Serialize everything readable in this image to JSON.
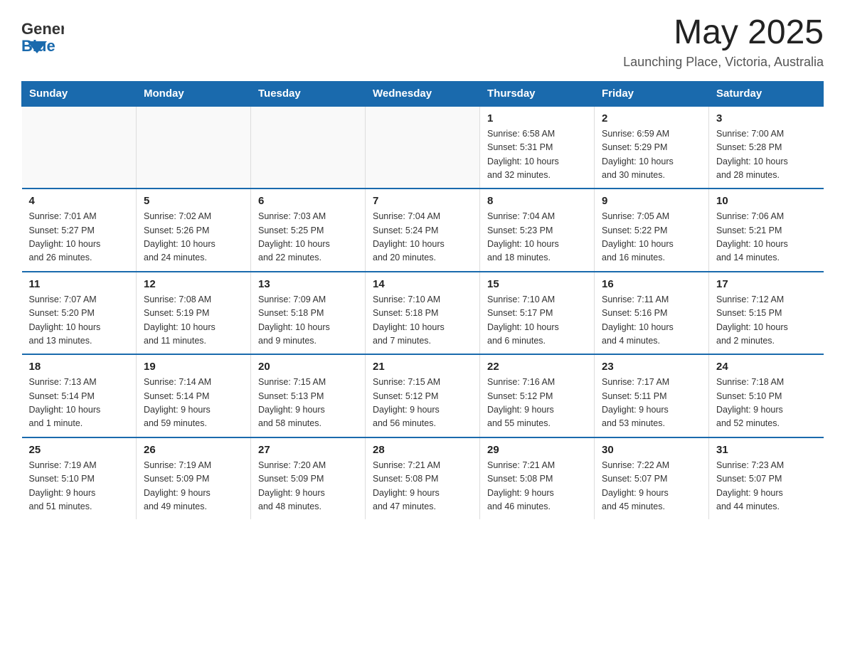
{
  "header": {
    "logo_general": "General",
    "logo_blue": "Blue",
    "month_year": "May 2025",
    "location": "Launching Place, Victoria, Australia"
  },
  "days_of_week": [
    "Sunday",
    "Monday",
    "Tuesday",
    "Wednesday",
    "Thursday",
    "Friday",
    "Saturday"
  ],
  "weeks": [
    [
      {
        "day": "",
        "info": ""
      },
      {
        "day": "",
        "info": ""
      },
      {
        "day": "",
        "info": ""
      },
      {
        "day": "",
        "info": ""
      },
      {
        "day": "1",
        "info": "Sunrise: 6:58 AM\nSunset: 5:31 PM\nDaylight: 10 hours\nand 32 minutes."
      },
      {
        "day": "2",
        "info": "Sunrise: 6:59 AM\nSunset: 5:29 PM\nDaylight: 10 hours\nand 30 minutes."
      },
      {
        "day": "3",
        "info": "Sunrise: 7:00 AM\nSunset: 5:28 PM\nDaylight: 10 hours\nand 28 minutes."
      }
    ],
    [
      {
        "day": "4",
        "info": "Sunrise: 7:01 AM\nSunset: 5:27 PM\nDaylight: 10 hours\nand 26 minutes."
      },
      {
        "day": "5",
        "info": "Sunrise: 7:02 AM\nSunset: 5:26 PM\nDaylight: 10 hours\nand 24 minutes."
      },
      {
        "day": "6",
        "info": "Sunrise: 7:03 AM\nSunset: 5:25 PM\nDaylight: 10 hours\nand 22 minutes."
      },
      {
        "day": "7",
        "info": "Sunrise: 7:04 AM\nSunset: 5:24 PM\nDaylight: 10 hours\nand 20 minutes."
      },
      {
        "day": "8",
        "info": "Sunrise: 7:04 AM\nSunset: 5:23 PM\nDaylight: 10 hours\nand 18 minutes."
      },
      {
        "day": "9",
        "info": "Sunrise: 7:05 AM\nSunset: 5:22 PM\nDaylight: 10 hours\nand 16 minutes."
      },
      {
        "day": "10",
        "info": "Sunrise: 7:06 AM\nSunset: 5:21 PM\nDaylight: 10 hours\nand 14 minutes."
      }
    ],
    [
      {
        "day": "11",
        "info": "Sunrise: 7:07 AM\nSunset: 5:20 PM\nDaylight: 10 hours\nand 13 minutes."
      },
      {
        "day": "12",
        "info": "Sunrise: 7:08 AM\nSunset: 5:19 PM\nDaylight: 10 hours\nand 11 minutes."
      },
      {
        "day": "13",
        "info": "Sunrise: 7:09 AM\nSunset: 5:18 PM\nDaylight: 10 hours\nand 9 minutes."
      },
      {
        "day": "14",
        "info": "Sunrise: 7:10 AM\nSunset: 5:18 PM\nDaylight: 10 hours\nand 7 minutes."
      },
      {
        "day": "15",
        "info": "Sunrise: 7:10 AM\nSunset: 5:17 PM\nDaylight: 10 hours\nand 6 minutes."
      },
      {
        "day": "16",
        "info": "Sunrise: 7:11 AM\nSunset: 5:16 PM\nDaylight: 10 hours\nand 4 minutes."
      },
      {
        "day": "17",
        "info": "Sunrise: 7:12 AM\nSunset: 5:15 PM\nDaylight: 10 hours\nand 2 minutes."
      }
    ],
    [
      {
        "day": "18",
        "info": "Sunrise: 7:13 AM\nSunset: 5:14 PM\nDaylight: 10 hours\nand 1 minute."
      },
      {
        "day": "19",
        "info": "Sunrise: 7:14 AM\nSunset: 5:14 PM\nDaylight: 9 hours\nand 59 minutes."
      },
      {
        "day": "20",
        "info": "Sunrise: 7:15 AM\nSunset: 5:13 PM\nDaylight: 9 hours\nand 58 minutes."
      },
      {
        "day": "21",
        "info": "Sunrise: 7:15 AM\nSunset: 5:12 PM\nDaylight: 9 hours\nand 56 minutes."
      },
      {
        "day": "22",
        "info": "Sunrise: 7:16 AM\nSunset: 5:12 PM\nDaylight: 9 hours\nand 55 minutes."
      },
      {
        "day": "23",
        "info": "Sunrise: 7:17 AM\nSunset: 5:11 PM\nDaylight: 9 hours\nand 53 minutes."
      },
      {
        "day": "24",
        "info": "Sunrise: 7:18 AM\nSunset: 5:10 PM\nDaylight: 9 hours\nand 52 minutes."
      }
    ],
    [
      {
        "day": "25",
        "info": "Sunrise: 7:19 AM\nSunset: 5:10 PM\nDaylight: 9 hours\nand 51 minutes."
      },
      {
        "day": "26",
        "info": "Sunrise: 7:19 AM\nSunset: 5:09 PM\nDaylight: 9 hours\nand 49 minutes."
      },
      {
        "day": "27",
        "info": "Sunrise: 7:20 AM\nSunset: 5:09 PM\nDaylight: 9 hours\nand 48 minutes."
      },
      {
        "day": "28",
        "info": "Sunrise: 7:21 AM\nSunset: 5:08 PM\nDaylight: 9 hours\nand 47 minutes."
      },
      {
        "day": "29",
        "info": "Sunrise: 7:21 AM\nSunset: 5:08 PM\nDaylight: 9 hours\nand 46 minutes."
      },
      {
        "day": "30",
        "info": "Sunrise: 7:22 AM\nSunset: 5:07 PM\nDaylight: 9 hours\nand 45 minutes."
      },
      {
        "day": "31",
        "info": "Sunrise: 7:23 AM\nSunset: 5:07 PM\nDaylight: 9 hours\nand 44 minutes."
      }
    ]
  ]
}
